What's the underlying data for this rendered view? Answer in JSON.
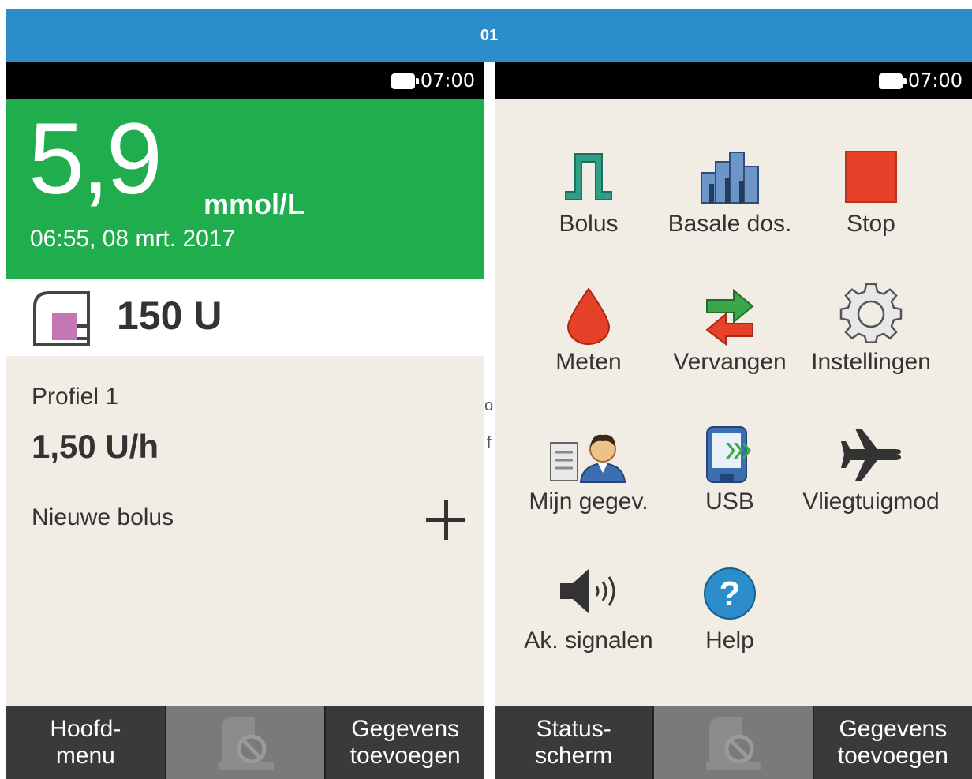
{
  "banner": {
    "title": "01"
  },
  "left_screen": {
    "status_time": "07:00",
    "glucose": {
      "value": "5,9",
      "unit": "mmol/L",
      "datetime": "06:55, 08 mrt. 2017"
    },
    "reservoir": {
      "amount": "150 U"
    },
    "profile": {
      "name": "Profiel 1",
      "rate": "1,50 U/h"
    },
    "new_bolus_label": "Nieuwe bolus",
    "bottom": {
      "left": [
        "Hoofd-",
        "menu"
      ],
      "right": [
        "Gegevens",
        "toevoegen"
      ]
    }
  },
  "right_screen": {
    "status_time": "07:00",
    "menu": [
      {
        "label": "Bolus",
        "icon": "bolus-icon"
      },
      {
        "label": "Basale dos.",
        "icon": "basal-rate-icon"
      },
      {
        "label": "Stop",
        "icon": "stop-icon"
      },
      {
        "label": "Meten",
        "icon": "blood-drop-icon"
      },
      {
        "label": "Vervangen",
        "icon": "swap-arrows-icon"
      },
      {
        "label": "Instellingen",
        "icon": "gear-icon"
      },
      {
        "label": "Mijn gegev.",
        "icon": "my-data-icon"
      },
      {
        "label": "USB",
        "icon": "usb-device-icon"
      },
      {
        "label": "Vliegtuigmod",
        "icon": "airplane-icon"
      },
      {
        "label": "Ak. signalen",
        "icon": "speaker-icon"
      },
      {
        "label": "Help",
        "icon": "help-icon"
      }
    ],
    "bottom": {
      "left": [
        "Status-",
        "scherm"
      ],
      "right": [
        "Gegevens",
        "toevoegen"
      ]
    }
  },
  "stray_text": [
    "o",
    "f"
  ],
  "colors": {
    "banner": "#2b8dc9",
    "glucose_bg": "#1fad4d",
    "screen_bg": "#f1ede4",
    "stop": "#e8412a",
    "bolus": "#2e9e87",
    "help": "#2b8dc9"
  }
}
